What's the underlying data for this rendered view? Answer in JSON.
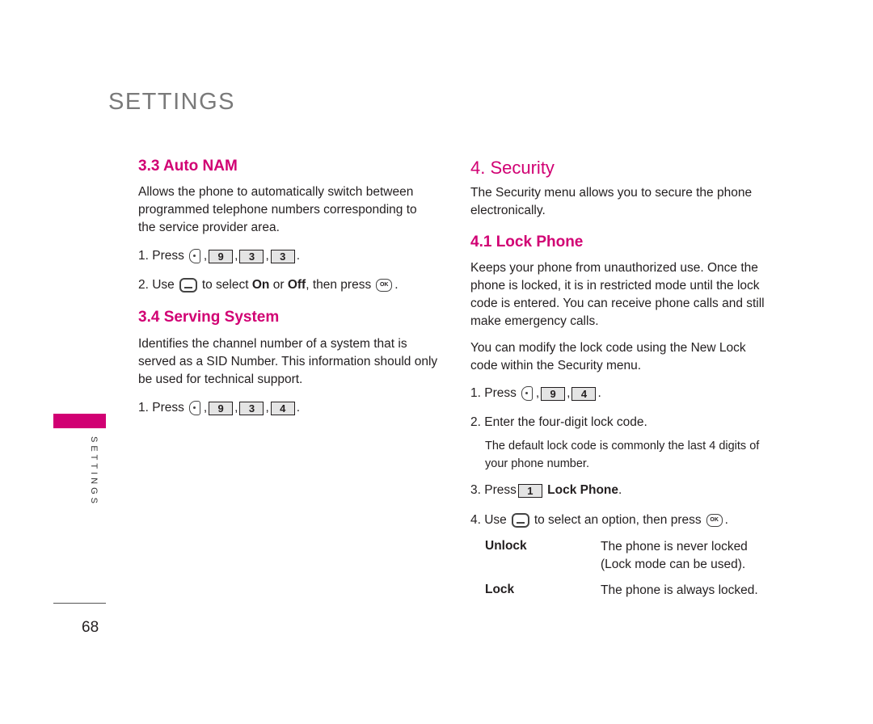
{
  "page": {
    "title": "SETTINGS",
    "side_tab": "SETTINGS",
    "page_number": "68",
    "accent_color": "#d10073"
  },
  "left": {
    "auto_nam": {
      "heading": "3.3 Auto NAM",
      "body": "Allows the phone to automatically switch between programmed telephone numbers corresponding to the service provider area.",
      "step1_prefix": "1. Press",
      "step1_keys": [
        "9",
        "3",
        "3"
      ],
      "step2_prefix": "2. Use",
      "step2_mid": "to select",
      "step2_on": "On",
      "step2_or": "or",
      "step2_off": "Off",
      "step2_end": ", then press"
    },
    "serving_system": {
      "heading": "3.4 Serving System",
      "body": "Identifies the channel number of a system that is served as a SID Number. This information should only be used for technical support.",
      "step1_prefix": "1. Press",
      "step1_keys": [
        "9",
        "3",
        "4"
      ]
    }
  },
  "right": {
    "security": {
      "heading": "4. Security",
      "body": "The Security menu allows you to secure the phone electronically."
    },
    "lock_phone": {
      "heading": "4.1 Lock Phone",
      "body1": "Keeps your phone from unauthorized use. Once the phone is locked, it is in restricted mode until the lock code is entered. You can receive phone calls and still make emergency calls.",
      "body2": "You can modify the lock code using the New Lock code within the Security menu.",
      "step1_prefix": "1. Press",
      "step1_keys": [
        "9",
        "4"
      ],
      "step2": "2. Enter the four-digit lock code.",
      "step2_note": "The default lock code is commonly the last 4 digits of your phone number.",
      "step3_prefix": "3. Press",
      "step3_key": "1",
      "step3_label": "Lock Phone",
      "step4_prefix": "4. Use",
      "step4_mid": "to select an option, then press",
      "options": [
        {
          "label": "Unlock",
          "desc": "The phone is never locked (Lock mode can be used)."
        },
        {
          "label": "Lock",
          "desc": "The phone is always locked."
        }
      ]
    }
  },
  "icons": {
    "menu_key": "menu-key-icon",
    "nav_key": "nav-key-icon",
    "ok_key": "ok-key-icon",
    "ok_text": "OK"
  }
}
